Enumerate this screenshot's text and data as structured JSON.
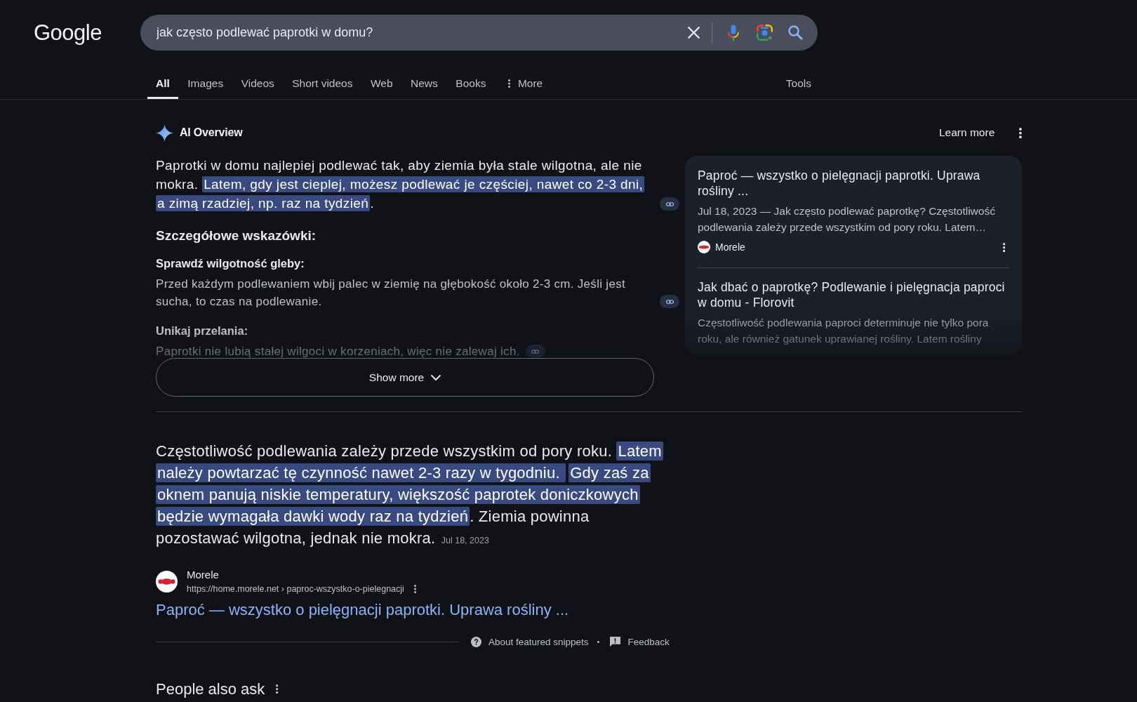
{
  "search_header": {
    "logo": "Google",
    "query": "jak często podlewać paprotki w domu?"
  },
  "tabs": [
    {
      "label": "All",
      "selected": true,
      "kind": "plain"
    },
    {
      "label": "Images",
      "selected": false,
      "kind": "plain"
    },
    {
      "label": "Videos",
      "selected": false,
      "kind": "plain"
    },
    {
      "label": "Short videos",
      "selected": false,
      "kind": "plain"
    },
    {
      "label": "Web",
      "selected": false,
      "kind": "plain"
    },
    {
      "label": "News",
      "selected": false,
      "kind": "plain"
    },
    {
      "label": "Books",
      "selected": false,
      "kind": "plain"
    },
    {
      "label": "More",
      "selected": false,
      "kind": "menu"
    }
  ],
  "tools": "Tools",
  "ai_overview": {
    "title": "AI Overview",
    "learn_more": "Learn more",
    "truncated": true,
    "summary": [
      {
        "text": "Paprotki w domu najlepiej podlewać tak, aby ziemia była stale wilgotna, ale nie mokra. ",
        "highlighted": false
      },
      {
        "text": "Latem, gdy jest cieplej, możesz podlewać je częściej, nawet co 2-3 dni, a zimą rzadziej, np. raz na tydzień",
        "highlighted": true
      },
      {
        "text": ".",
        "highlighted": false
      }
    ],
    "subheading": "Szczegółowe wskazówki:",
    "tips": [
      {
        "heading": "Sprawdź wilgotność gleby:",
        "text": "Przed każdym podlewaniem wbij palec w ziemię na głębokość około 2-3 cm. Jeśli jest sucha, to czas na podlewanie."
      },
      {
        "heading": "Unikaj przelania:",
        "text": "Paprotki nie lubią stałej wilgoci w korzeniach, więc nie zalewaj ich."
      }
    ],
    "show_more": "Show more",
    "sources_truncated": true,
    "sources": [
      {
        "title": "Paproć — wszystko o pielęgnacji paprotki. Uprawa rośliny ...",
        "snippet": "Jul 18, 2023 — Jak często podlewać paprotkę? Częstotliwość podlewania zależy przede wszystkim od pory roku. Latem…",
        "site": "Morele"
      },
      {
        "title": "Jak dbać o paprotkę? Podlewanie i pielęgnacja paproci w domu - Florovit",
        "snippet": "Częstotliwość podlewania paproci determinuje nie tylko pora roku, ale również gatunek uprawianej rośliny. Latem rośliny"
      }
    ]
  },
  "featured_snippet": {
    "segments": [
      {
        "text": "Częstotliwość podlewania zależy przede wszystkim od pory roku. ",
        "highlighted": false
      },
      {
        "text": "Latem należy powtarzać tę czynność nawet 2-3 razy w tygodniu. ",
        "highlighted": true
      },
      {
        "text": "Gdy zaś za oknem panują niskie temperatury, większość paprotek doniczkowych będzie wymagała dawki wody raz na tydzień",
        "highlighted": true
      },
      {
        "text": ". Ziemia powinna pozostawać wilgotna, jednak nie mokra.",
        "highlighted": false
      }
    ],
    "date": "Jul 18, 2023",
    "source": {
      "name": "Morele",
      "url": "https://home.morele.net › paproc-wszystko-o-pielegnacji"
    },
    "title": "Paproć — wszystko o pielęgnacji paprotki. Uprawa rośliny ...",
    "about": "About featured snippets",
    "separator": "•",
    "feedback": "Feedback"
  },
  "people_also_ask": {
    "title": "People also ask"
  }
}
